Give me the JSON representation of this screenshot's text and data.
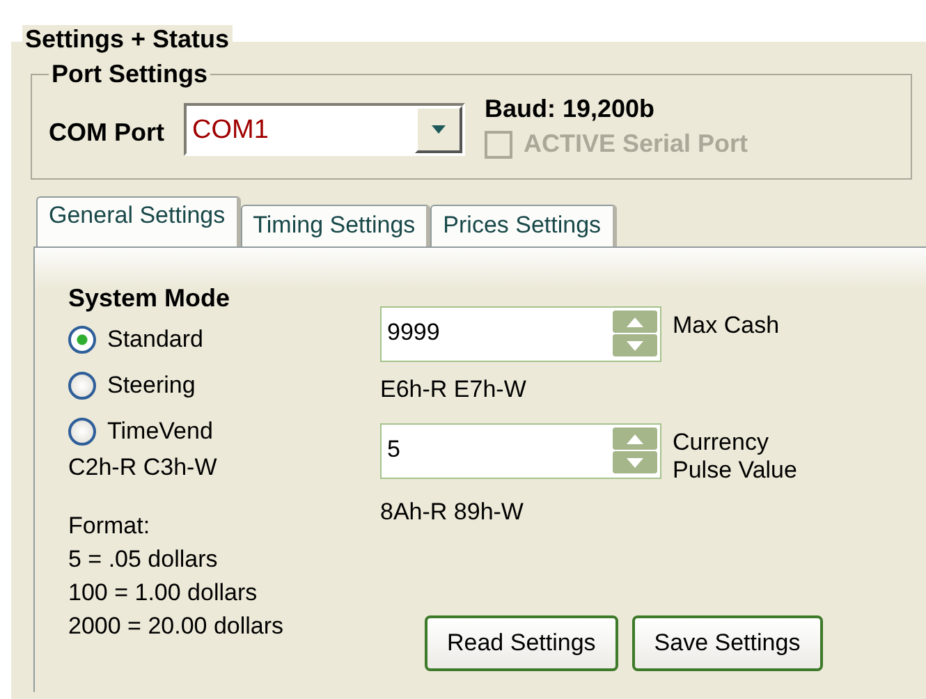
{
  "group_title": "Settings + Status",
  "port_settings": {
    "title": "Port Settings",
    "com_label": "COM Port",
    "com_value": "COM1",
    "baud": "Baud: 19,200b",
    "active": {
      "label": "ACTIVE Serial Port",
      "checked": false,
      "disabled": true
    }
  },
  "tabs": [
    {
      "label": "General Settings",
      "selected": true
    },
    {
      "label": "Timing Settings",
      "selected": false
    },
    {
      "label": "Prices Settings",
      "selected": false
    }
  ],
  "system_mode": {
    "title": "System Mode",
    "options": [
      {
        "label": "Standard",
        "selected": true
      },
      {
        "label": "Steering",
        "selected": false
      },
      {
        "label": "TimeVend",
        "selected": false
      }
    ],
    "registers": "C2h-R C3h-W"
  },
  "format": [
    "Format:",
    "5 = .05 dollars",
    "100 = 1.00 dollars",
    "2000 = 20.00 dollars"
  ],
  "fields": [
    {
      "value": "9999",
      "label": "Max Cash",
      "registers": "E6h-R E7h-W"
    },
    {
      "value": "5",
      "label": "Currency Pulse Value",
      "registers": "8Ah-R 89h-W"
    }
  ],
  "buttons": [
    "Read Settings",
    "Save Settings"
  ]
}
